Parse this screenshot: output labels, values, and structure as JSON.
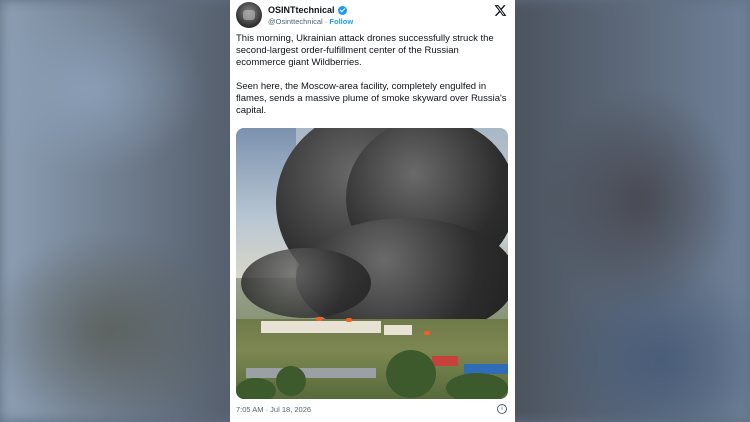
{
  "post": {
    "display_name": "OSINTtechnical",
    "handle": "@Osinttechnical",
    "separator": "·",
    "follow_label": "Follow",
    "paragraphs": [
      "This morning, Ukrainian attack drones successfully struck the second-largest order-fulfillment center of the Russian ecommerce giant Wildberries.",
      "Seen here, the Moscow-area facility, completely engulfed in flames, sends a massive plume of smoke skyward over Russia's capital."
    ],
    "timestamp": "7:05 AM · Jul 18, 2026",
    "close_glyph": "𝕏",
    "info_glyph": "i"
  },
  "colors": {
    "accent": "#1d9bf0",
    "text": "#0f1419",
    "muted": "#536471"
  },
  "icons": {
    "verified": "verified-badge-icon",
    "x_logo": "x-logo-icon",
    "info": "info-icon"
  }
}
